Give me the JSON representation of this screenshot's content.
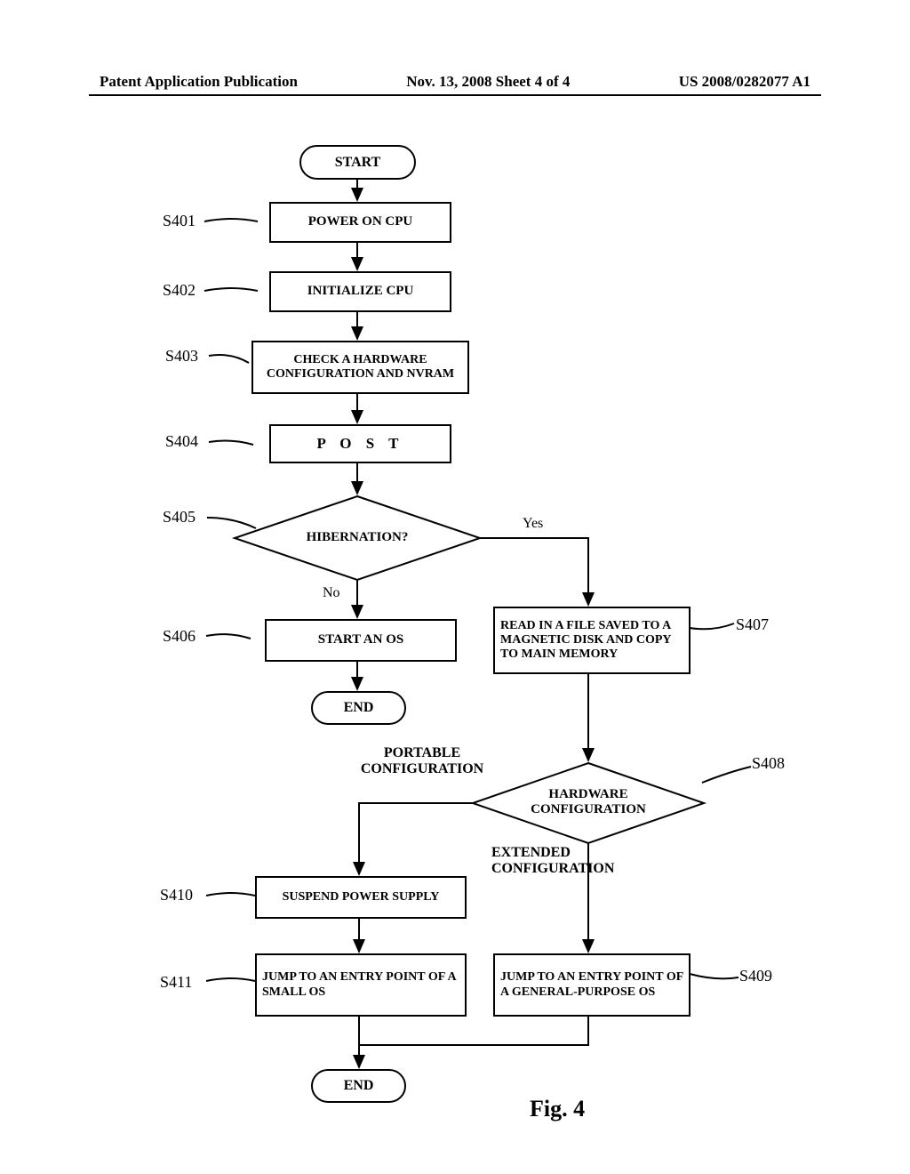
{
  "header": {
    "left": "Patent Application Publication",
    "center": "Nov. 13, 2008  Sheet 4 of 4",
    "right": "US 2008/0282077 A1"
  },
  "terminators": {
    "start": "START",
    "end1": "END",
    "end2": "END"
  },
  "steps": {
    "s401": "POWER ON CPU",
    "s402": "INITIALIZE CPU",
    "s403": "CHECK A HARDWARE CONFIGURATION AND NVRAM",
    "s404": "P O S T",
    "s405": "HIBERNATION?",
    "s406": "START AN OS",
    "s407": "READ IN A FILE SAVED TO A MAGNETIC DISK AND COPY TO MAIN MEMORY",
    "s408": "HARDWARE CONFIGURATION",
    "s409": "JUMP TO AN ENTRY POINT OF A GENERAL-PURPOSE OS",
    "s410": "SUSPEND POWER SUPPLY",
    "s411": "JUMP TO AN ENTRY POINT OF A SMALL OS"
  },
  "refs": {
    "s401": "S401",
    "s402": "S402",
    "s403": "S403",
    "s404": "S404",
    "s405": "S405",
    "s406": "S406",
    "s407": "S407",
    "s408": "S408",
    "s409": "S409",
    "s410": "S410",
    "s411": "S411"
  },
  "edges": {
    "yes": "Yes",
    "no": "No",
    "portable": "PORTABLE CONFIGURATION",
    "extended": "EXTENDED CONFIGURATION"
  },
  "figure_caption": "Fig. 4"
}
